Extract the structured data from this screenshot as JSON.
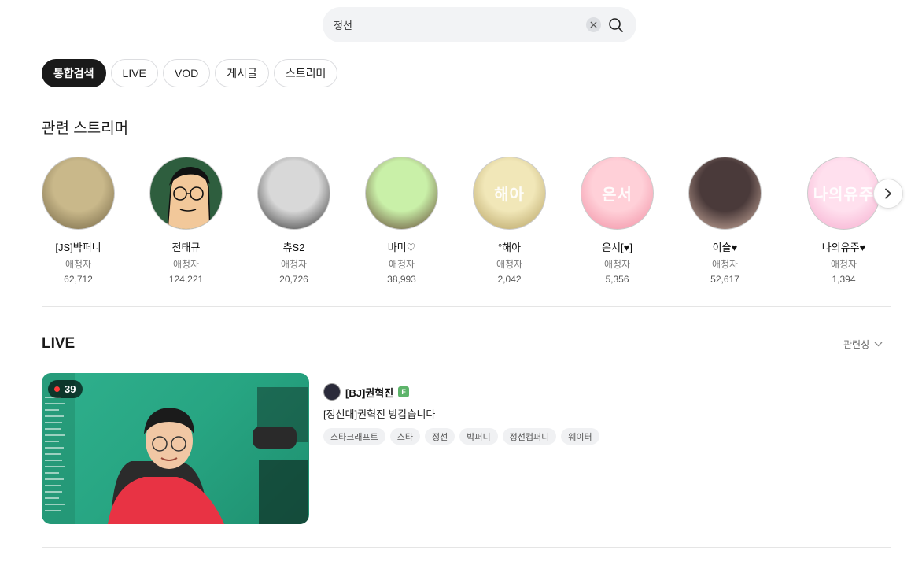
{
  "search": {
    "value": "정선"
  },
  "tabs": [
    {
      "label": "통합검색",
      "active": true
    },
    {
      "label": "LIVE",
      "active": false
    },
    {
      "label": "VOD",
      "active": false
    },
    {
      "label": "게시글",
      "active": false
    },
    {
      "label": "스트리머",
      "active": false
    }
  ],
  "streamers_section": {
    "title": "관련 스트리머",
    "items": [
      {
        "name": "[JS]박퍼니",
        "label": "애청자",
        "count": "62,712",
        "avatar_text": "",
        "avatar_colors": [
          "#c9b88a",
          "#6e6040"
        ]
      },
      {
        "name": "전태규",
        "label": "애청자",
        "count": "124,221",
        "avatar_text": "",
        "avatar_colors": [
          "#2e5e3e",
          "#f2c89a"
        ]
      },
      {
        "name": "츄S2",
        "label": "애청자",
        "count": "20,726",
        "avatar_text": "",
        "avatar_colors": [
          "#d8d8d8",
          "#2a2a2a"
        ]
      },
      {
        "name": "바미♡",
        "label": "애청자",
        "count": "38,993",
        "avatar_text": "",
        "avatar_colors": [
          "#c9f0a8",
          "#5a3a2a"
        ]
      },
      {
        "name": "°해아",
        "label": "애청자",
        "count": "2,042",
        "avatar_text": "해아",
        "avatar_colors": [
          "#f1e7b8",
          "#b09a5a"
        ]
      },
      {
        "name": "은서[♥]",
        "label": "애청자",
        "count": "5,356",
        "avatar_text": "은서",
        "avatar_colors": [
          "#ffd0d8",
          "#f08aa0"
        ]
      },
      {
        "name": "이슬♥",
        "label": "애청자",
        "count": "52,617",
        "avatar_text": "",
        "avatar_colors": [
          "#4a3a3a",
          "#d9b8a8"
        ]
      },
      {
        "name": "나의유주♥",
        "label": "애청자",
        "count": "1,394",
        "avatar_text": "나의유주",
        "avatar_colors": [
          "#ffe0ee",
          "#f5a8cc"
        ]
      }
    ]
  },
  "live_section": {
    "title": "LIVE",
    "sort_label": "관련성",
    "streams": [
      {
        "viewers": "39",
        "channel_name": "[BJ]권혁진",
        "badge": "F",
        "title": "[정선대]권혁진 방갑습니다",
        "tags": [
          "스타크래프트",
          "스타",
          "정선",
          "박퍼니",
          "정선컴퍼니",
          "웨이터"
        ]
      }
    ]
  },
  "colors": {
    "accent": "#1a1a1a",
    "live_dot": "#ff3b3b",
    "fan_badge": "#5db46a",
    "thumb_bg": "#27a582"
  },
  "icons": {
    "clear": "close-icon",
    "search": "search-icon",
    "next": "chevron-right-icon",
    "sort": "chevron-down-icon"
  }
}
